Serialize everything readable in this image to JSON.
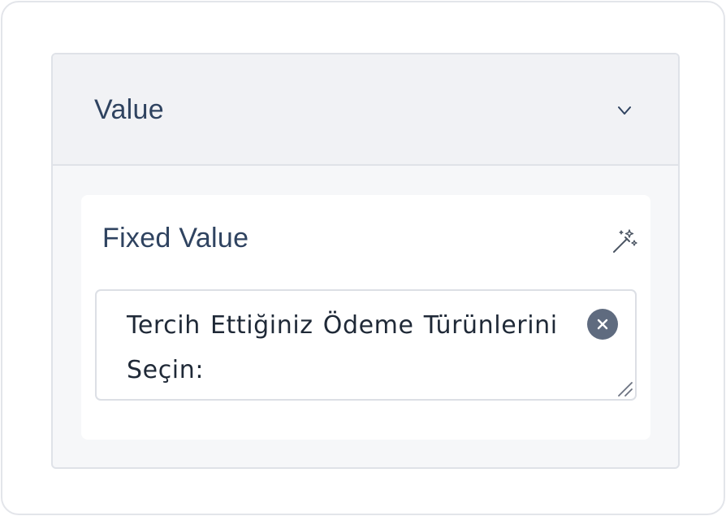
{
  "panel": {
    "title": "Value",
    "collapse_icon": "chevron-down-icon"
  },
  "field": {
    "label": "Fixed Value",
    "magic_icon": "magic-wand-icon",
    "value": "Tercih Ettiğiniz Ödeme Türünlerini Seçin:",
    "clear_icon": "close-icon",
    "resize_icon": "resize-handle-icon"
  },
  "colors": {
    "heading_text": "#2f4360",
    "body_text": "#1f2937",
    "header_bg": "#f1f2f5",
    "panel_bg": "#f6f7f9",
    "border": "#dfe2e8",
    "clear_button": "#5f6b7f"
  }
}
